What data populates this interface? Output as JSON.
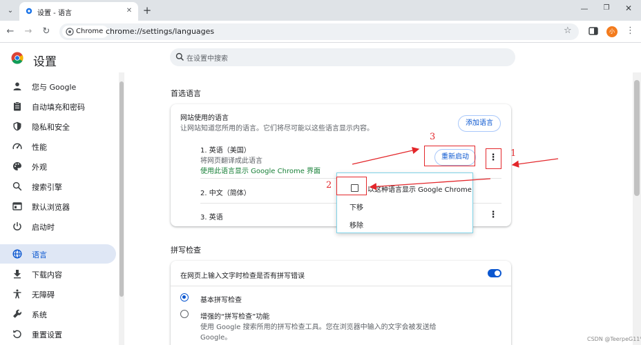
{
  "browser": {
    "tab_title": "设置 - 语言",
    "omnibox_chip": "Chrome",
    "url": "chrome://settings/languages",
    "avatar_initial": "小"
  },
  "settings": {
    "title": "设置",
    "search_placeholder": "在设置中搜索"
  },
  "sidebar": {
    "items": [
      {
        "label": "您与 Google",
        "icon": "person-icon"
      },
      {
        "label": "自动填充和密码",
        "icon": "clipboard-icon"
      },
      {
        "label": "隐私和安全",
        "icon": "shield-icon"
      },
      {
        "label": "性能",
        "icon": "speedometer-icon"
      },
      {
        "label": "外观",
        "icon": "palette-icon"
      },
      {
        "label": "搜索引擎",
        "icon": "search-icon"
      },
      {
        "label": "默认浏览器",
        "icon": "browser-icon"
      },
      {
        "label": "启动时",
        "icon": "power-icon"
      },
      {
        "label": "语言",
        "icon": "globe-icon",
        "active": true
      },
      {
        "label": "下载内容",
        "icon": "download-icon"
      },
      {
        "label": "无障碍",
        "icon": "accessibility-icon"
      },
      {
        "label": "系统",
        "icon": "wrench-icon"
      },
      {
        "label": "重置设置",
        "icon": "reset-icon"
      }
    ]
  },
  "preferred_languages": {
    "section_title": "首选语言",
    "card_title": "网站使用的语言",
    "card_desc": "让网站知道您所用的语言。它们将尽可能以这些语言显示内容。",
    "add_button": "添加语言",
    "languages": [
      {
        "label": "1. 英语（美国）",
        "sub": "将网页翻译成此语言",
        "note": "使用此语言显示 Google Chrome 界面",
        "action": "重新启动"
      },
      {
        "label": "2. 中文（简体）"
      },
      {
        "label": "3. 英语"
      }
    ]
  },
  "context_menu": {
    "items": [
      "以这种语言显示 Google Chrome",
      "下移",
      "移除"
    ]
  },
  "spellcheck": {
    "section_title": "拼写检查",
    "toggle_label": "在网页上输入文字时检查是否有拼写错误",
    "toggle_on": true,
    "basic_label": "基本拼写检查",
    "enhanced_label": "增强的“拼写检查”功能",
    "enhanced_desc_1": "使用 Google 搜索所用的拼写检查工具。您在浏览器中输入的文字会被发送给",
    "enhanced_desc_2": "Google。"
  },
  "annotations": [
    "1",
    "2",
    "3"
  ],
  "colors": {
    "accent": "#0b57d0",
    "annotation_red": "#e3262a",
    "green_note": "#188038"
  },
  "watermark": "CSDN @TeerpeG11%"
}
